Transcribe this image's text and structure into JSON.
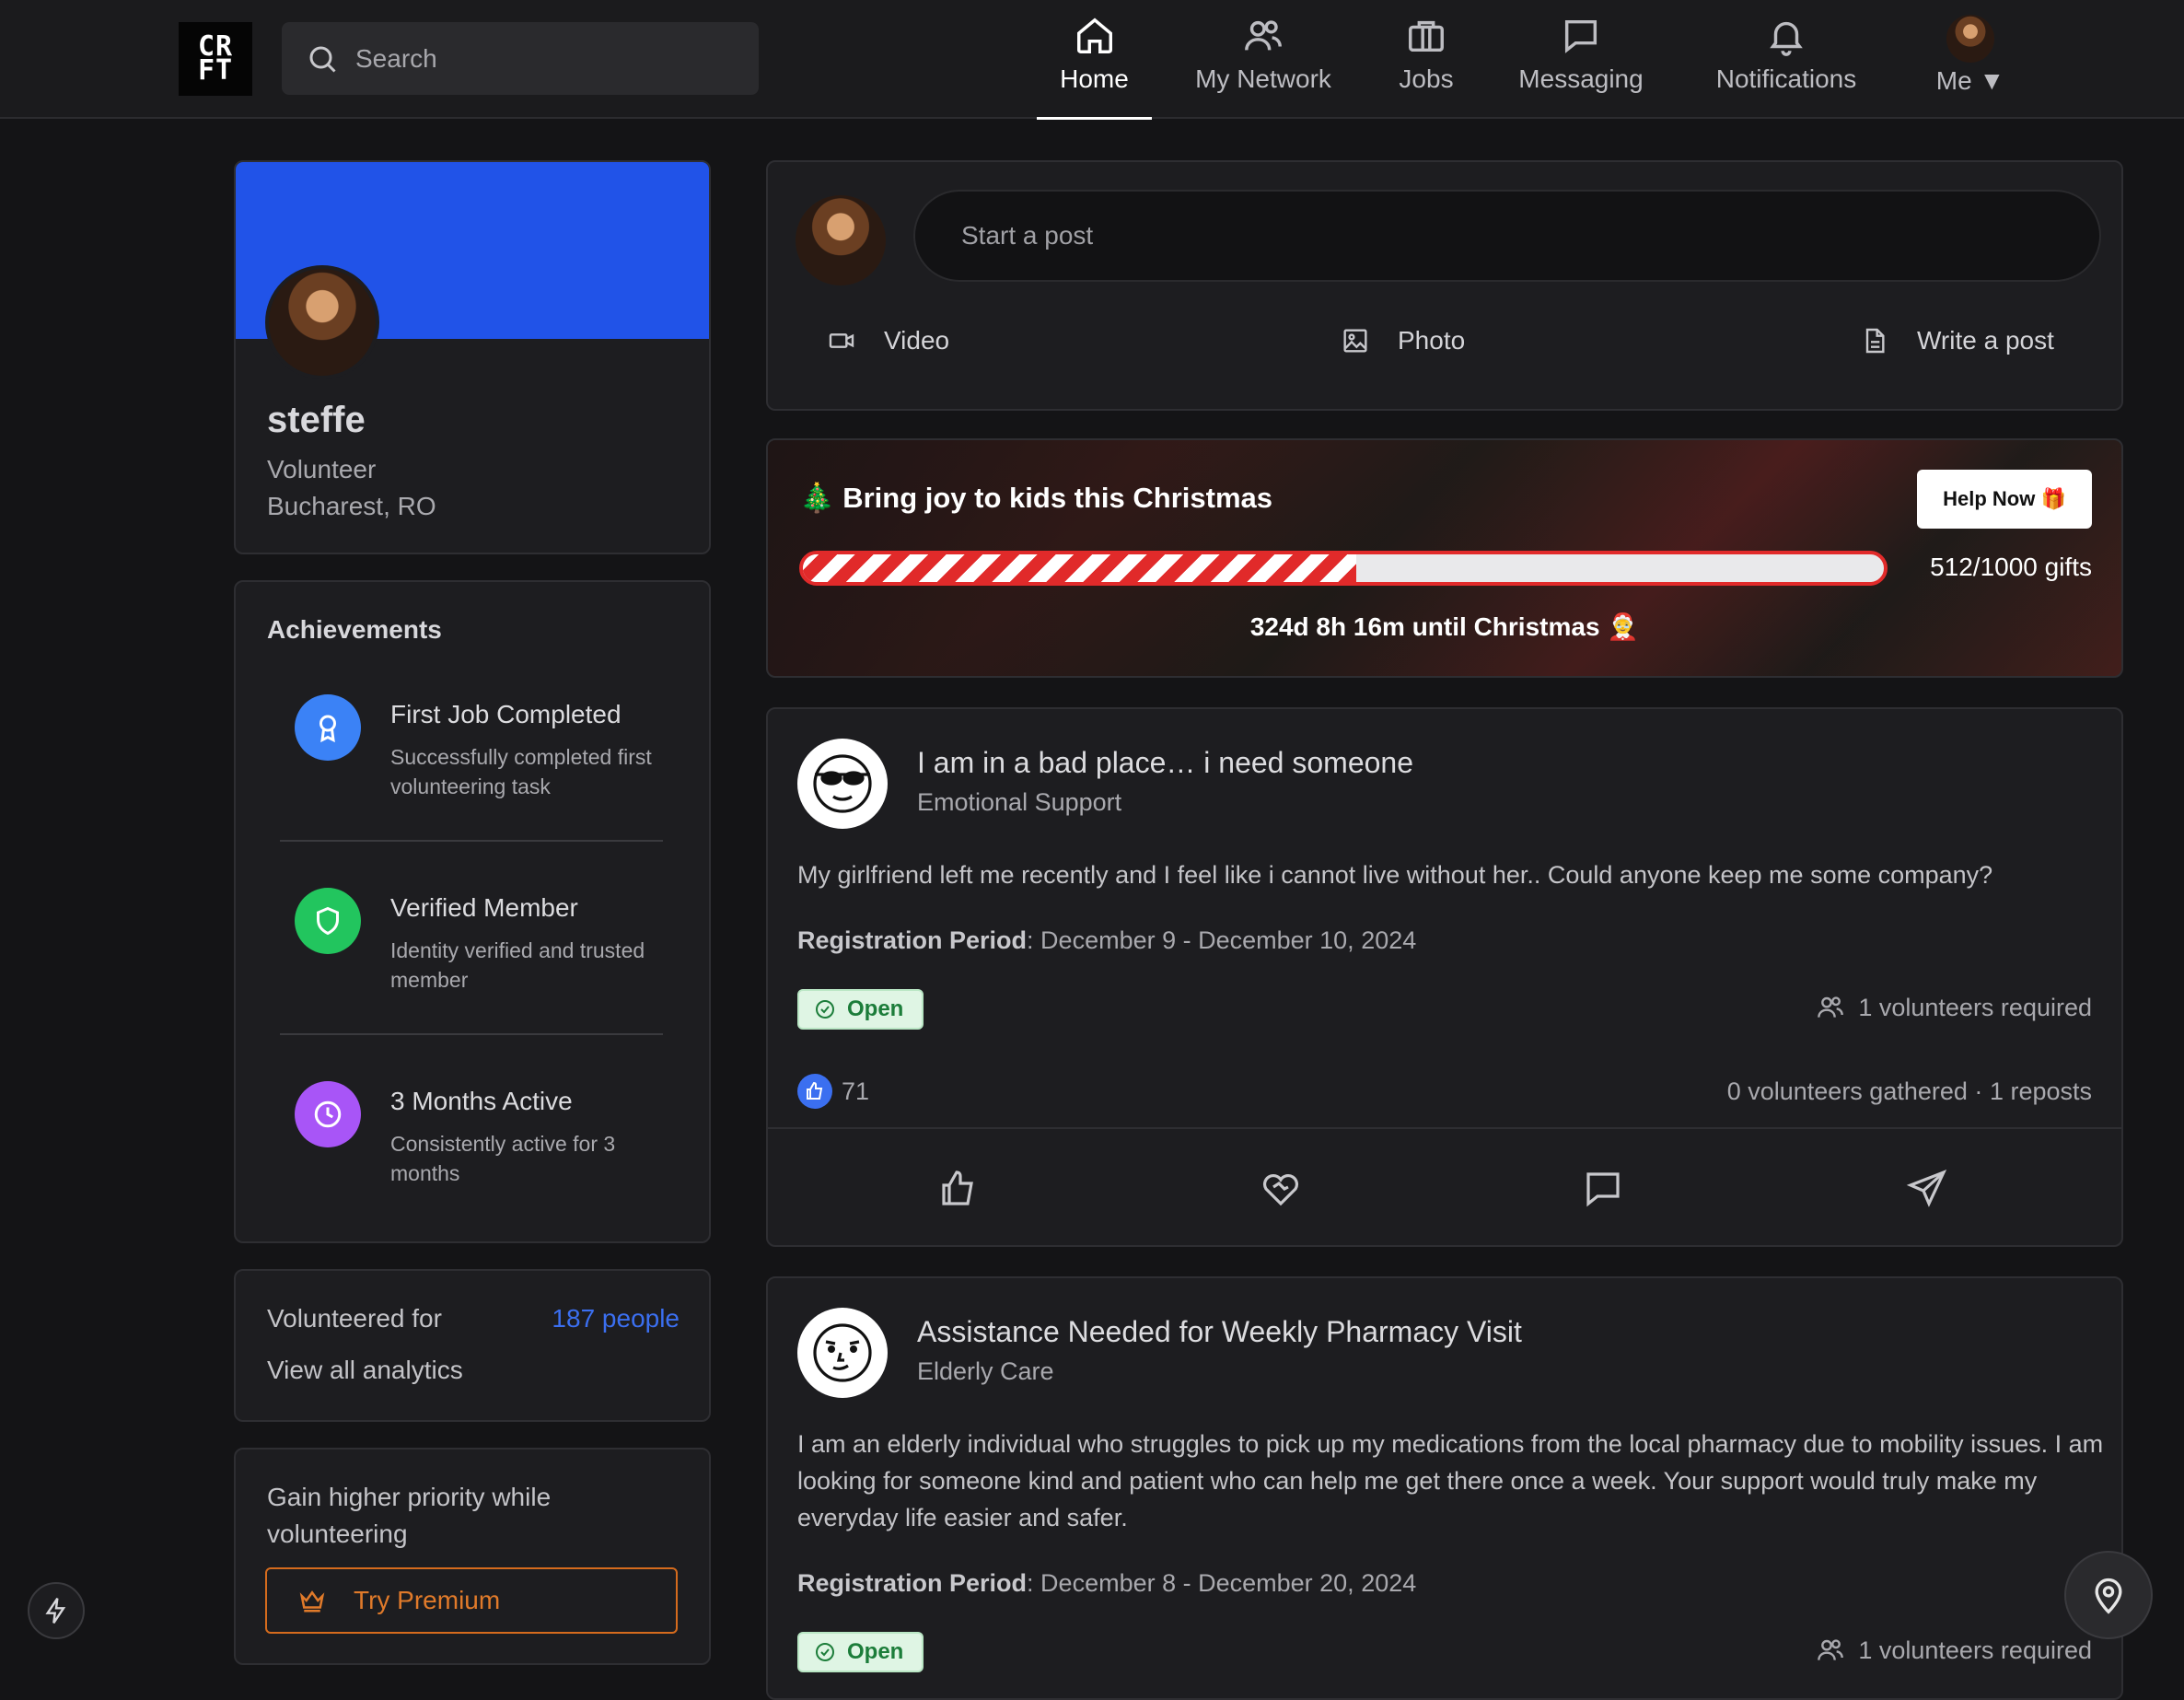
{
  "logo": {
    "line1": "CR",
    "line2": "FT"
  },
  "search": {
    "placeholder": "Search"
  },
  "nav": [
    {
      "label": "Home",
      "icon": "home-icon",
      "active": true
    },
    {
      "label": "My Network",
      "icon": "people-icon"
    },
    {
      "label": "Jobs",
      "icon": "briefcase-icon"
    },
    {
      "label": "Messaging",
      "icon": "message-icon"
    },
    {
      "label": "Notifications",
      "icon": "bell-icon"
    },
    {
      "label": "Me ▼",
      "icon": "avatar"
    }
  ],
  "profile": {
    "name": "steffe",
    "role": "Volunteer",
    "location": "Bucharest, RO"
  },
  "achievements": {
    "heading": "Achievements",
    "items": [
      {
        "title": "First Job Completed",
        "desc": "Successfully completed first volunteering task",
        "color": "#3b82f6",
        "icon": "award-icon"
      },
      {
        "title": "Verified Member",
        "desc": "Identity verified and trusted member",
        "color": "#22c55e",
        "icon": "shield-icon"
      },
      {
        "title": "3 Months Active",
        "desc": "Consistently active for 3 months",
        "color": "#a855f7",
        "icon": "clock-icon"
      }
    ]
  },
  "analytics": {
    "label": "Volunteered for",
    "value": "187 people",
    "link": "View all analytics"
  },
  "premium": {
    "text": "Gain higher priority while volunteering",
    "button": "Try Premium"
  },
  "composer": {
    "placeholder": "Start a post",
    "video": "Video",
    "photo": "Photo",
    "write": "Write a post"
  },
  "campaign": {
    "title": "🎄 Bring joy to kids this Christmas",
    "button": "Help Now 🎁",
    "gifts": "512/1000 gifts",
    "progress": 0.512,
    "countdown": "324d 8h 16m until Christmas 🤶"
  },
  "posts": [
    {
      "title": "I am in a bad place… i need someone",
      "category": "Emotional Support",
      "body": "My girlfriend left me recently and I feel like i cannot live without her.. Could anyone keep me some company?",
      "reg_label": "Registration Period",
      "reg_value": ": December 9 - December 10, 2024",
      "status": "Open",
      "required": "1 volunteers required",
      "likes": "71",
      "gathered": "0 volunteers gathered",
      "reposts": "1 reposts"
    },
    {
      "title": "Assistance Needed for Weekly Pharmacy Visit",
      "category": "Elderly Care",
      "body": "I am an elderly individual who struggles to pick up my medications from the local pharmacy due to mobility issues. I am looking for someone kind and patient who can help me get there once a week. Your support would truly make my everyday life easier and safer.",
      "reg_label": "Registration Period",
      "reg_value": ": December 8 - December 20, 2024",
      "status": "Open",
      "required": "1 volunteers required"
    }
  ],
  "colors": {
    "accent": "#2153e8",
    "premium": "#d56b1d",
    "open_bg": "#dff5e4",
    "link": "#3b6ff0"
  }
}
